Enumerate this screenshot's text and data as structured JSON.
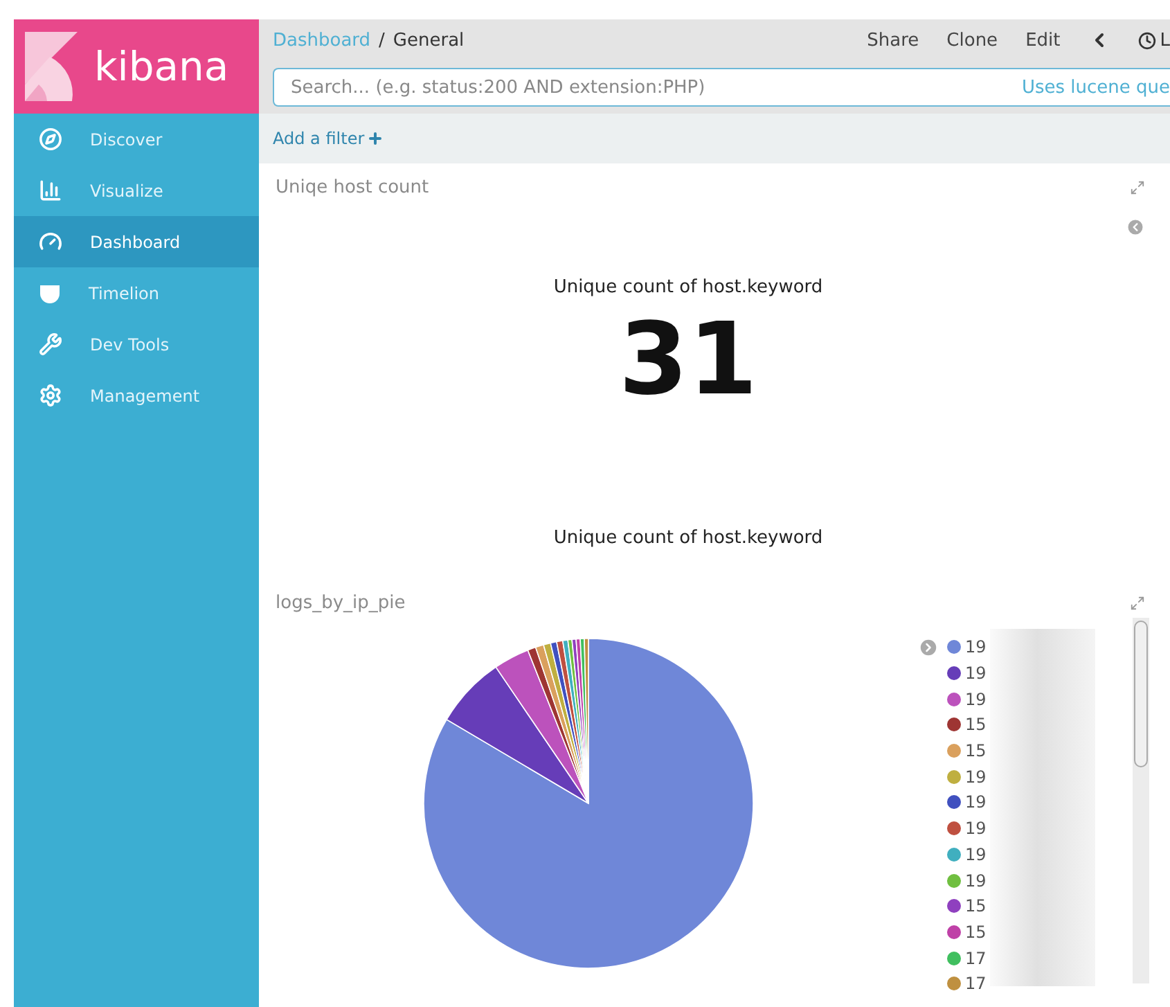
{
  "logo": {
    "text": "kibana"
  },
  "nav": [
    {
      "label": "Discover",
      "selected": false
    },
    {
      "label": "Visualize",
      "selected": false
    },
    {
      "label": "Dashboard",
      "selected": true
    },
    {
      "label": "Timelion",
      "selected": false
    },
    {
      "label": "Dev Tools",
      "selected": false
    },
    {
      "label": "Management",
      "selected": false
    }
  ],
  "breadcrumb": {
    "parent": "Dashboard",
    "separator": "/",
    "current": "General"
  },
  "actions": [
    {
      "kind": "text",
      "label": "Share"
    },
    {
      "kind": "text",
      "label": "Clone"
    },
    {
      "kind": "text",
      "label": "Edit"
    },
    {
      "kind": "chevron"
    },
    {
      "kind": "time",
      "label": "L"
    }
  ],
  "search": {
    "placeholder": "Search... (e.g. status:200 AND extension:PHP)",
    "hint": "Uses lucene que"
  },
  "filter": {
    "label": "Add a filter"
  },
  "panels": [
    {
      "kind": "metric",
      "title": "Uniqe host count",
      "metric_label": "Unique count of host.keyword",
      "value": "31",
      "footer_label": "Unique count of host.keyword"
    },
    {
      "kind": "pie",
      "title": "logs_by_ip_pie",
      "legend": [
        {
          "label": "19",
          "color": "#6f87d8"
        },
        {
          "label": "19",
          "color": "#663db8"
        },
        {
          "label": "19",
          "color": "#bc52bc"
        },
        {
          "label": "15",
          "color": "#9e3533"
        },
        {
          "label": "15",
          "color": "#daa05d"
        },
        {
          "label": "19",
          "color": "#bfaf40"
        },
        {
          "label": "19",
          "color": "#4050bf"
        },
        {
          "label": "19",
          "color": "#bf5040"
        },
        {
          "label": "19",
          "color": "#40afbf"
        },
        {
          "label": "19",
          "color": "#70bf40"
        },
        {
          "label": "15",
          "color": "#8f40bf"
        },
        {
          "label": "15",
          "color": "#bf40a7"
        },
        {
          "label": "17",
          "color": "#40bf5f"
        },
        {
          "label": "17",
          "color": "#bf9040"
        }
      ]
    }
  ]
}
